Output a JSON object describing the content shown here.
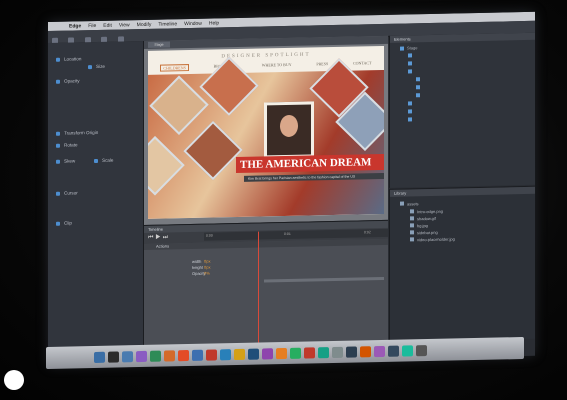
{
  "menubar": {
    "app": "Edge",
    "items": [
      "File",
      "Edit",
      "View",
      "Modify",
      "Timeline",
      "Window",
      "Help"
    ]
  },
  "stage": {
    "tab": "Stage",
    "spotlight": "DESIGNER SPOTLIGHT",
    "nav": [
      "CHILDRENS",
      "BIOGRAPHY",
      "WHERE TO BUY",
      "PRESS",
      "CONTACT"
    ],
    "headline": "THE AMERICAN DREAM",
    "caption": "Kim Brat brings her Parisian aesthetic to the fashion capital of the US"
  },
  "properties": {
    "rows": [
      {
        "label": "Location",
        "value": ""
      },
      {
        "label": "Size",
        "value": ""
      },
      {
        "label": "Opacity",
        "value": ""
      },
      {
        "label": "Transform Origin",
        "value": ""
      },
      {
        "label": "Rotate",
        "value": ""
      },
      {
        "label": "Skew",
        "value": ""
      },
      {
        "label": "Scale",
        "value": ""
      },
      {
        "label": "Cursor",
        "value": ""
      },
      {
        "label": "Clip",
        "value": ""
      }
    ]
  },
  "elements_panel": {
    "title": "Elements",
    "items": [
      "Stage",
      "",
      "",
      "",
      "",
      "",
      "",
      "",
      "",
      "",
      "",
      ""
    ]
  },
  "library_panel": {
    "title": "Library",
    "folder": "assets",
    "files": [
      "Intro-edge.png",
      "shadow.gif",
      "bg.jpg",
      "sidebar.png",
      "video-placeholder.jpg"
    ]
  },
  "timeline": {
    "title": "Timeline",
    "actions_label": "Actions",
    "ruler": [
      "0:00",
      "0:01",
      "0:02"
    ],
    "tracks": [
      {
        "name": "width",
        "value": "0px"
      },
      {
        "name": "height",
        "value": "0px"
      },
      {
        "name": "Opacity",
        "value": "0%"
      }
    ]
  },
  "dock_colors": [
    "#3a6ea5",
    "#2b2b2b",
    "#4a7bb0",
    "#8a5cc2",
    "#2e8b57",
    "#d46a2a",
    "#e34c26",
    "#3d6fb0",
    "#c0392b",
    "#2980b9",
    "#d4a017",
    "#1f4e79",
    "#8e44ad",
    "#e67e22",
    "#27ae60",
    "#c0392b",
    "#16a085",
    "#7f8c8d",
    "#2c3e50",
    "#d35400",
    "#9b59b6",
    "#34495e",
    "#1abc9c",
    "#555"
  ]
}
